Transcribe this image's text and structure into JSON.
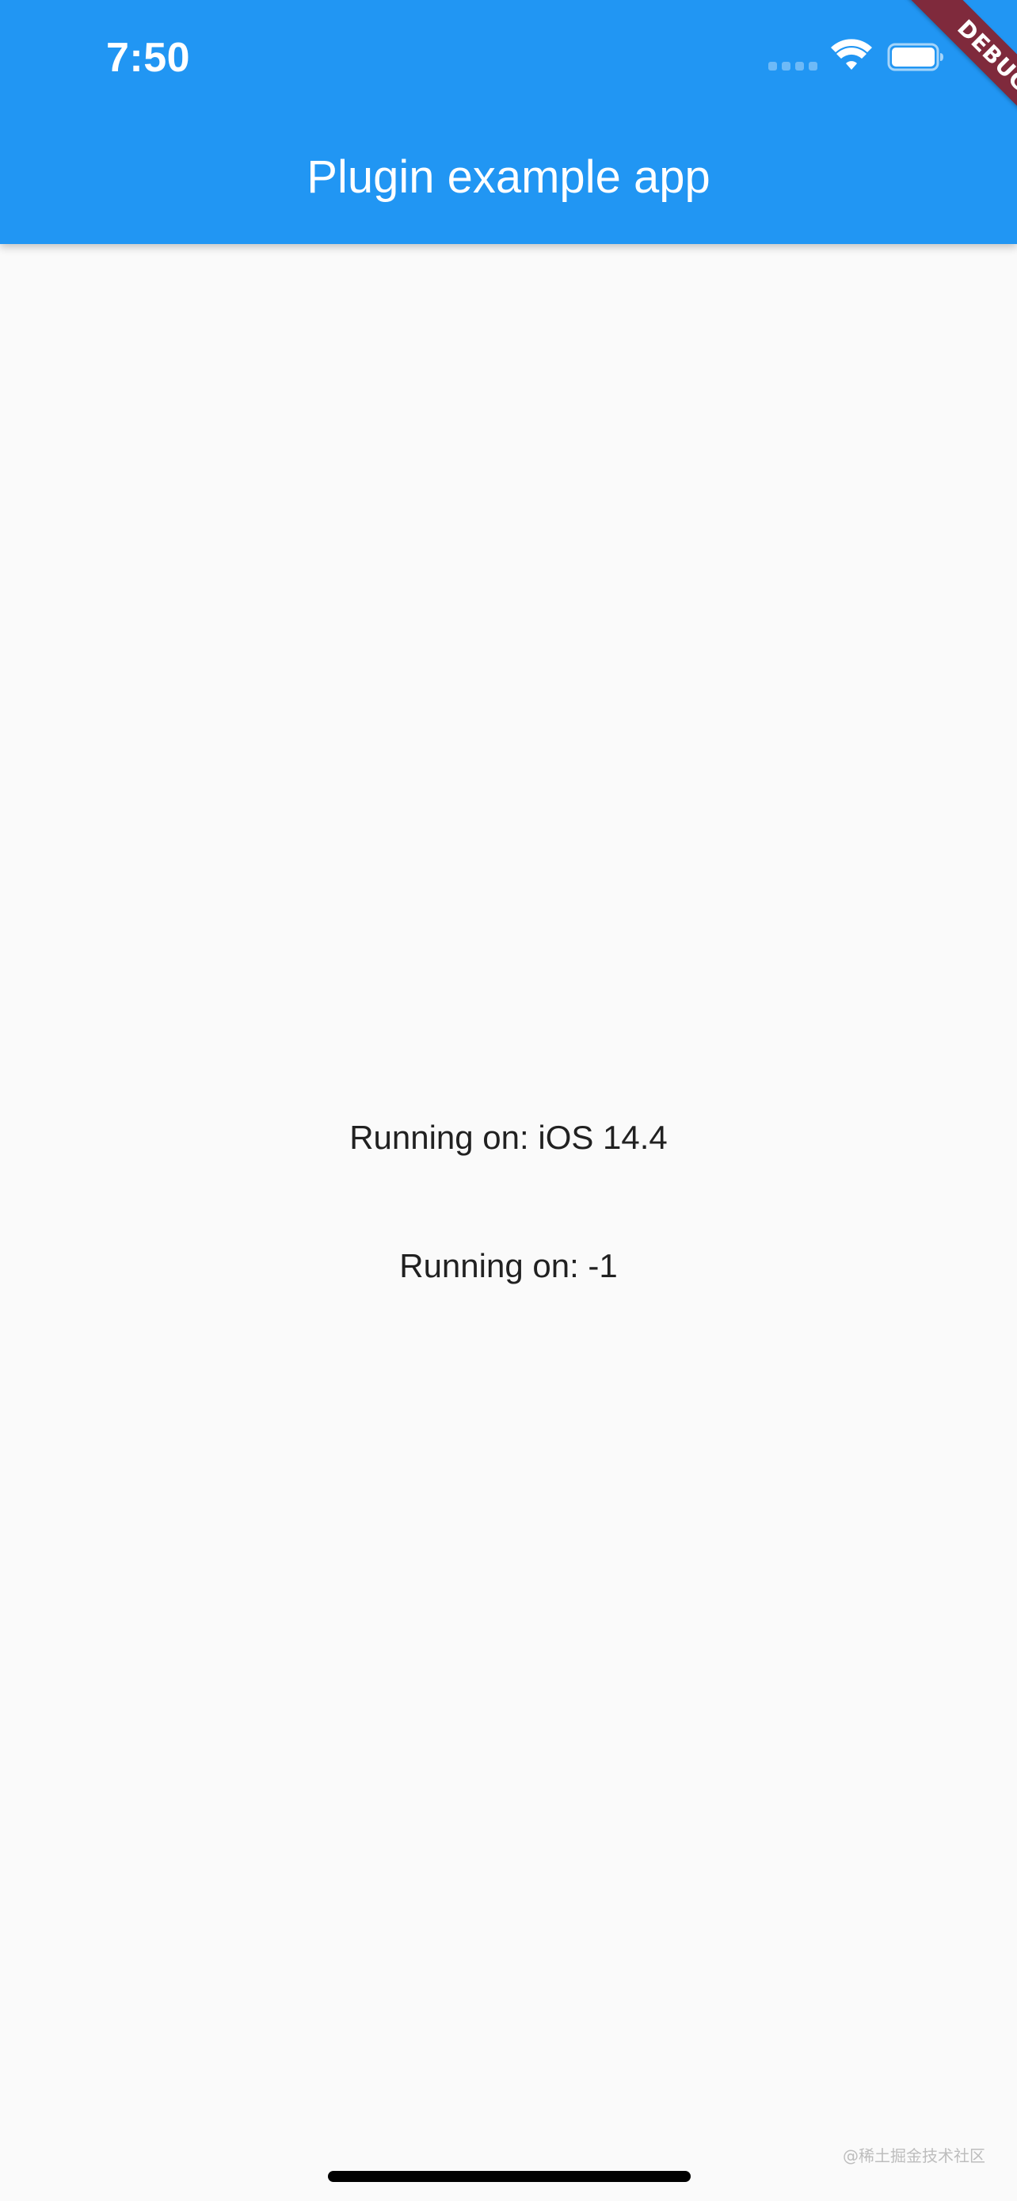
{
  "status_bar": {
    "time": "7:50",
    "signal_icon": "cellular-signal-icon",
    "wifi_icon": "wifi-icon",
    "battery_icon": "battery-icon"
  },
  "app_bar": {
    "title": "Plugin example app",
    "color": "#2196f3"
  },
  "debug_banner": {
    "label": "DEBUG",
    "color": "#7f2a3c"
  },
  "main": {
    "lines": [
      "Running on: iOS 14.4",
      "Running on: -1"
    ]
  },
  "watermark": "@稀土掘金技术社区",
  "colors": {
    "background": "#fafafa",
    "text": "#212121"
  }
}
